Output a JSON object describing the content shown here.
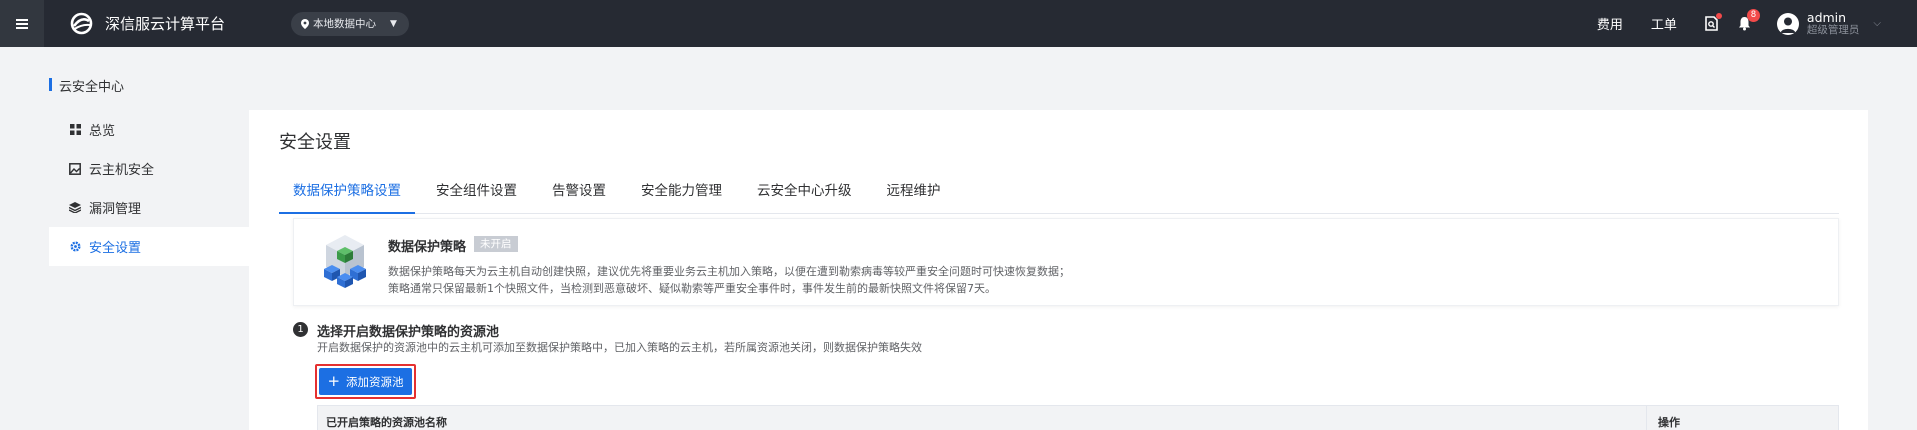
{
  "header": {
    "app_title": "深信服云计算平台",
    "datacenter": "本地数据中心",
    "links": {
      "billing": "费用",
      "ticket": "工单"
    },
    "notification_count": "8",
    "user": {
      "name": "admin",
      "role": "超级管理员"
    },
    "colors": {
      "bar": "#262a33",
      "accent": "#1c6fe3",
      "alert": "#f24a4a"
    }
  },
  "page": {
    "title": "云安全中心"
  },
  "sidebar": {
    "items": [
      {
        "label": "总览",
        "icon": "grid-icon"
      },
      {
        "label": "云主机安全",
        "icon": "image-icon"
      },
      {
        "label": "漏洞管理",
        "icon": "layers-icon"
      },
      {
        "label": "安全设置",
        "icon": "gear-icon",
        "active": true
      }
    ]
  },
  "main": {
    "title": "安全设置",
    "tabs": [
      {
        "label": "数据保护策略设置",
        "active": true
      },
      {
        "label": "安全组件设置"
      },
      {
        "label": "告警设置"
      },
      {
        "label": "安全能力管理"
      },
      {
        "label": "云安全中心升级"
      },
      {
        "label": "远程维护"
      }
    ],
    "policy": {
      "title": "数据保护策略",
      "status": "未开启",
      "desc_line1": "数据保护策略每天为云主机自动创建快照，建议优先将重要业务云主机加入策略，以便在遭到勒索病毒等较严重安全问题时可快速恢复数据；",
      "desc_line2": "策略通常只保留最新1个快照文件，当检测到恶意破坏、疑似勒索等严重安全事件时，事件发生前的最新快照文件将保留7天。"
    },
    "step": {
      "number": "1",
      "title": "选择开启数据保护策略的资源池",
      "desc": "开启数据保护的资源池中的云主机可添加至数据保护策略中，已加入策略的云主机，若所属资源池关闭，则数据保护策略失效",
      "add_button": "添加资源池"
    },
    "table": {
      "columns": [
        "已开启策略的资源池名称",
        "操作"
      ]
    }
  }
}
